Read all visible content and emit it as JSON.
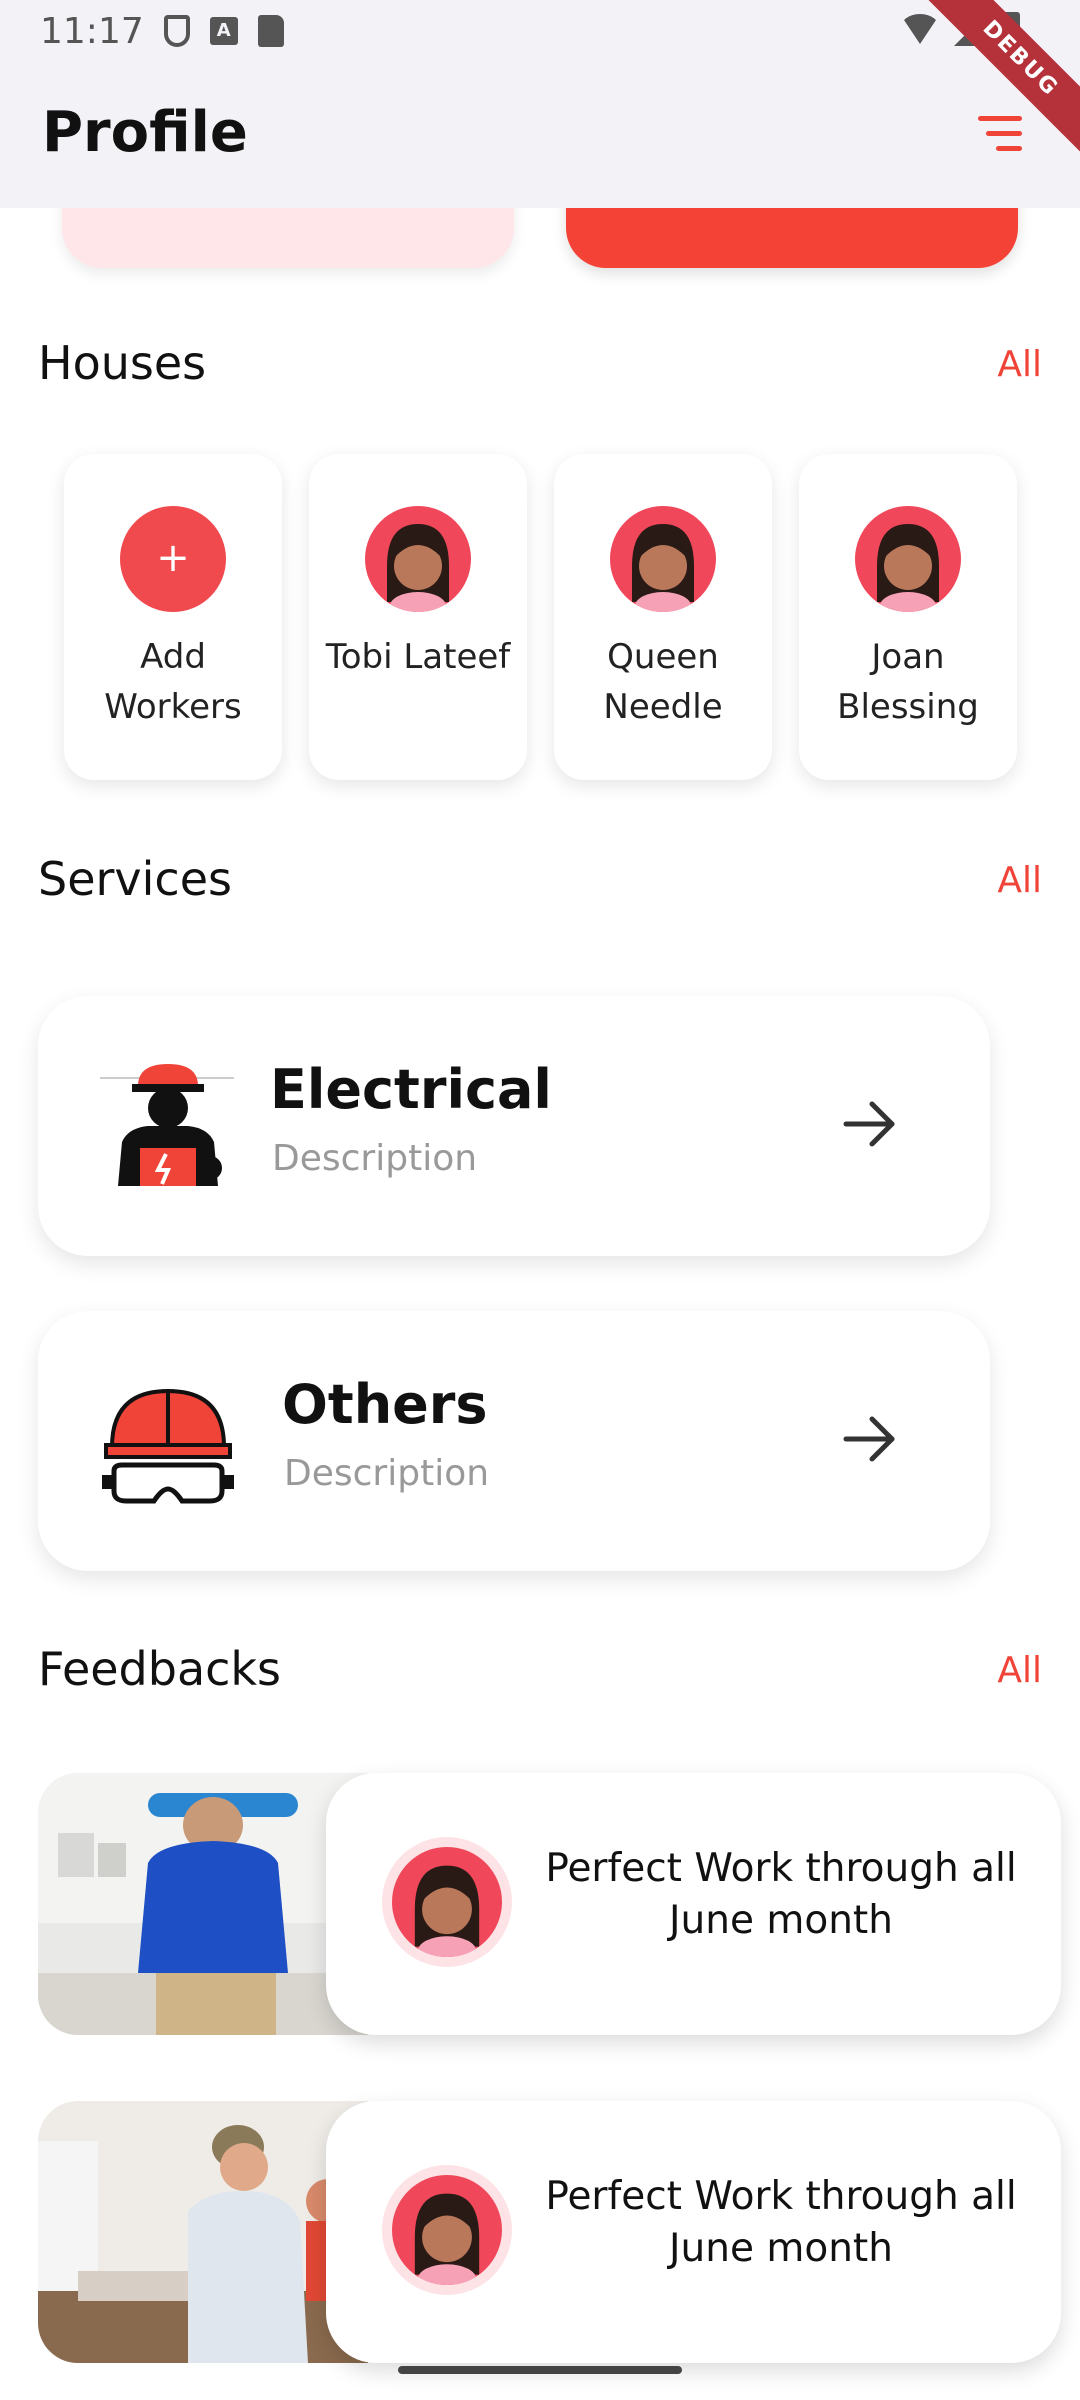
{
  "status_bar": {
    "time": "11:17",
    "a_badge": "A"
  },
  "debug_banner": "DEBUG",
  "app_bar": {
    "title": "Profile"
  },
  "houses": {
    "title": "Houses",
    "all_label": "All",
    "workers": [
      {
        "label": "Add Workers",
        "icon": "plus-icon"
      },
      {
        "label": "Tobi Lateef"
      },
      {
        "label": "Queen Needle"
      },
      {
        "label": "Joan Blessing"
      }
    ],
    "plus_symbol": "+"
  },
  "services": {
    "title": "Services",
    "all_label": "All",
    "items": [
      {
        "title": "Electrical",
        "description": "Description",
        "icon": "electrician-icon"
      },
      {
        "title": "Others",
        "description": "Description",
        "icon": "helmet-goggles-icon"
      }
    ]
  },
  "feedbacks": {
    "title": "Feedbacks",
    "all_label": "All",
    "items": [
      {
        "text": "Perfect Work through all June month"
      },
      {
        "text": "Perfect Work through all June month"
      }
    ]
  },
  "colors": {
    "accent": "#f04438",
    "card_pink": "#ffe6e9",
    "card_red": "#f44336"
  }
}
